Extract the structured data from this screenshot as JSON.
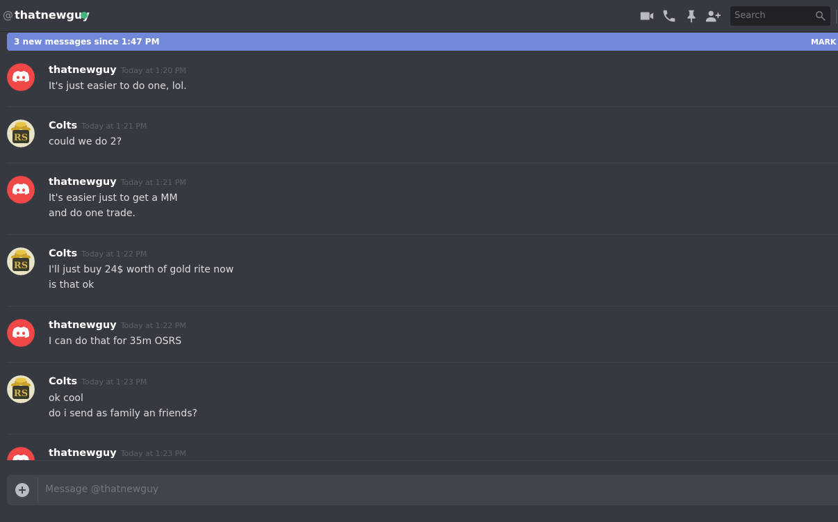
{
  "header": {
    "at_symbol": "@",
    "username": "thatnewguy",
    "status": "online",
    "search_placeholder": "Search",
    "icons": [
      "video-call-icon",
      "voice-call-icon",
      "pin-icon",
      "add-friend-icon",
      "search-icon"
    ]
  },
  "new_messages_bar": {
    "text": "3 new messages since 1:47 PM",
    "action": "MARK A"
  },
  "messages": [
    {
      "author": "thatnewguy",
      "timestamp": "Today at 1:20 PM",
      "lines": [
        "It's just easier to do one, lol."
      ]
    },
    {
      "author": "Colts",
      "timestamp": "Today at 1:21 PM",
      "lines": [
        "could we do 2?"
      ]
    },
    {
      "author": "thatnewguy",
      "timestamp": "Today at 1:21 PM",
      "lines": [
        "It's easier just to get a MM",
        "and do one trade."
      ]
    },
    {
      "author": "Colts",
      "timestamp": "Today at 1:22 PM",
      "lines": [
        "I'll just buy 24$ worth of gold rite now",
        "is that ok"
      ]
    },
    {
      "author": "thatnewguy",
      "timestamp": "Today at 1:22 PM",
      "lines": [
        "I can do that for 35m OSRS"
      ]
    },
    {
      "author": "Colts",
      "timestamp": "Today at 1:23 PM",
      "lines": [
        "ok cool",
        "do i send as family an friends?"
      ]
    },
    {
      "author": "thatnewguy",
      "timestamp": "Today at 1:23 PM",
      "lines": []
    }
  ],
  "composer": {
    "placeholder": "Message @thatnewguy"
  },
  "colors": {
    "background": "#36393f",
    "accent": "#7289da",
    "online": "#43b581",
    "discord_red": "#f04747"
  }
}
